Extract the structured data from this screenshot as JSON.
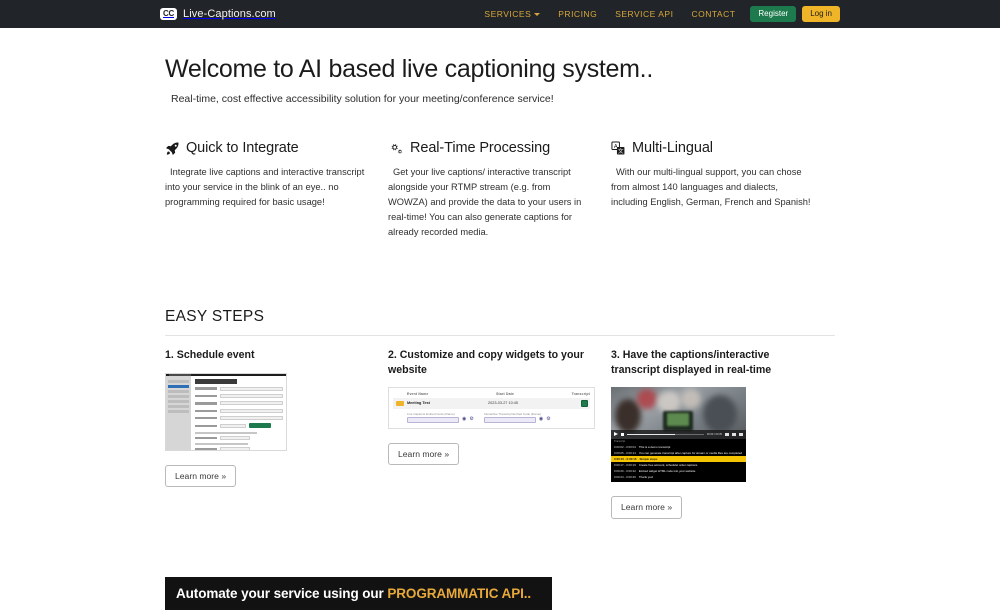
{
  "navbar": {
    "logo_icon": "cc-badge-icon",
    "logo_badge": "CC",
    "brand": "Live-Captions.com",
    "links": [
      {
        "label": "SERVICES",
        "has_caret": true
      },
      {
        "label": "PRICING",
        "has_caret": false
      },
      {
        "label": "SERVICE API",
        "has_caret": false
      },
      {
        "label": "CONTACT",
        "has_caret": false
      }
    ],
    "register_label": "Register",
    "login_label": "Log in",
    "colors": {
      "bg": "#212529",
      "link": "#d8a73a",
      "register": "#1d7a4c",
      "login": "#f0b429"
    }
  },
  "hero": {
    "title": "Welcome to AI based live captioning system..",
    "subtitle": "Real-time, cost effective accessibility solution for your meeting/conference service!"
  },
  "features": [
    {
      "icon": "rocket-icon",
      "title": "Quick to Integrate",
      "body": "Integrate live captions and interactive transcript into your service in the blink of an eye.. no programming required for basic usage!"
    },
    {
      "icon": "cogs-icon",
      "title": "Real-Time Processing",
      "body": "Get your live captions/ interactive transcript alongside your RTMP stream (e.g. from WOWZA) and provide the data to your users in real-time! You can also generate captions for already recorded media."
    },
    {
      "icon": "language-icon",
      "title": "Multi-Lingual",
      "body": "With our multi-lingual support, you can chose from almost 140 languages and dialects, including English, German, French and Spanish!"
    }
  ],
  "steps_section": {
    "title": "EASY STEPS",
    "learn_more_label": "Learn more »",
    "steps": [
      {
        "heading": "1. Schedule event",
        "thumb": "schedule-form-thumbnail"
      },
      {
        "heading": "2. Customize and copy widgets to your website",
        "thumb": "widget-table-thumbnail"
      },
      {
        "heading": "3. Have the captions/interactive transcript displayed in real-time",
        "thumb": "player-transcript-thumbnail"
      }
    ]
  },
  "thumb_schedule": {
    "form_title": "Schedule Live Capture",
    "fields": [
      "Event Name",
      "Event Start Date",
      "Event Time Zone",
      "Event Language",
      "Streaming URL",
      "Target Price"
    ],
    "submit_label": "Submit"
  },
  "thumb_widgets": {
    "columns": [
      "Event Name",
      "Start Date",
      "Transcript"
    ],
    "row": {
      "name": "Meeting Test",
      "date": "2023-03-27 10:45"
    },
    "control_labels": [
      "Live Captions Embed Code (iframe)",
      "Interactive Transcript Embed Code (iframe)"
    ],
    "select_value": "<iframe src=\"https://live..."
  },
  "thumb_player": {
    "time_label": "00:00 / 00:35",
    "transcript_header": "Transcript",
    "lines": [
      {
        "ts": "0:00:02 - 0:00:04",
        "text": "This is a demo transcript",
        "highlight": false
      },
      {
        "ts": "0:00:05 - 0:00:14",
        "text": "You can generate transcript after capture for stream or media files are completed",
        "highlight": false
      },
      {
        "ts": "0:00:15 - 0:00:16",
        "text": "Simple steps",
        "highlight": true
      },
      {
        "ts": "0:00:17 - 0:00:19",
        "text": "Create free account, schedule/ order captions",
        "highlight": false
      },
      {
        "ts": "0:00:20 - 0:00:22",
        "text": "Embed widget HTML code into your website",
        "highlight": false
      },
      {
        "ts": "0:00:24 - 0:00:26",
        "text": "Thank you!",
        "highlight": false
      }
    ]
  },
  "banner": {
    "text_plain": "Automate your service using our ",
    "text_accent": "PROGRAMMATIC API..",
    "accent_color": "#e8a93a"
  }
}
